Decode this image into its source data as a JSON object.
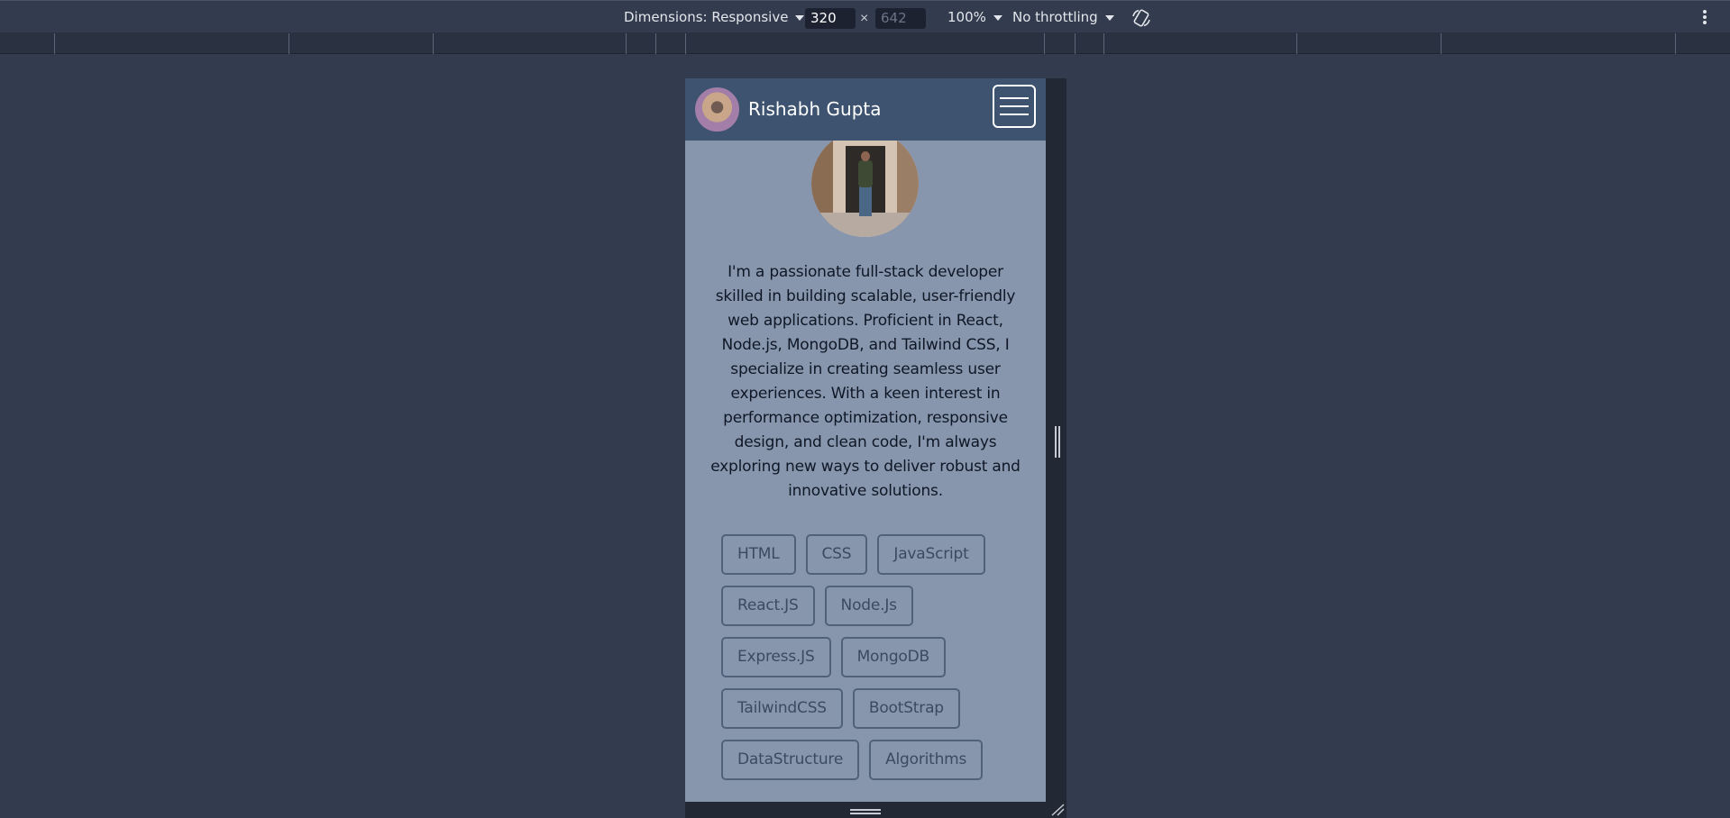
{
  "devtools": {
    "dimensions_label": "Dimensions: Responsive",
    "width_value": "320",
    "times_symbol": "×",
    "height_placeholder": "642",
    "zoom": "100%",
    "throttling": "No throttling",
    "rotate_icon": "rotate-icon",
    "menu_icon": "kebab-menu-icon"
  },
  "page": {
    "nav_title": "Rishabh Gupta",
    "bio": "I'm a passionate full-stack developer skilled in building scalable, user-friendly web applications. Proficient in React, Node.js, MongoDB, and Tailwind CSS, I specialize in creating seamless user experiences. With a keen interest in performance optimization, responsive design, and clean code, I'm always exploring new ways to deliver robust and innovative solutions.",
    "skill_rows": [
      [
        "HTML",
        "CSS",
        "JavaScript"
      ],
      [
        "React.JS",
        "Node.Js"
      ],
      [
        "Express.JS",
        "MongoDB"
      ],
      [
        "TailwindCSS",
        "BootStrap"
      ],
      [
        "DataStructure",
        "Algorithms"
      ]
    ]
  },
  "colors": {
    "devtools_bg": "#333c4e",
    "navbar": "#3d5370",
    "page_bg": "#8796ad",
    "skill_border": "#52617a"
  }
}
